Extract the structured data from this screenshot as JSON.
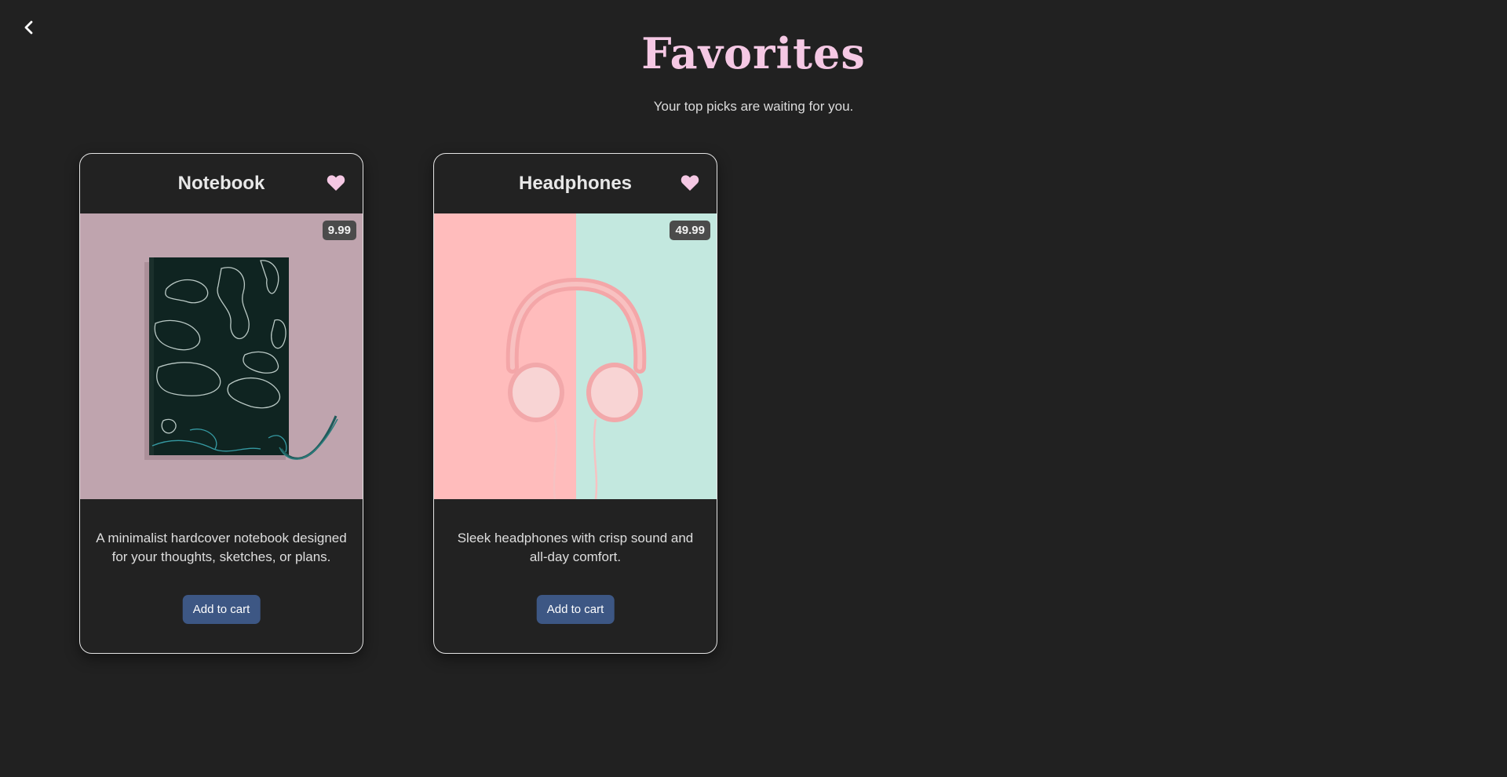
{
  "nav": {
    "back_icon": "chevron-left-icon"
  },
  "header": {
    "title": "Favorites",
    "subtitle": "Your top picks are waiting for you.",
    "title_color": "#f5c8e4"
  },
  "products": [
    {
      "name": "Notebook",
      "price": "9.99",
      "description": "A minimalist hardcover notebook designed for your thoughts, sketches, or plans.",
      "button_label": "Add to cart",
      "favorite_icon": "heart-icon"
    },
    {
      "name": "Headphones",
      "price": "49.99",
      "description": "Sleek headphones with crisp sound and all-day comfort.",
      "button_label": "Add to cart",
      "favorite_icon": "heart-icon"
    }
  ],
  "colors": {
    "background": "#212121",
    "heart": "#f5c8e4",
    "button": "#3d5784"
  }
}
